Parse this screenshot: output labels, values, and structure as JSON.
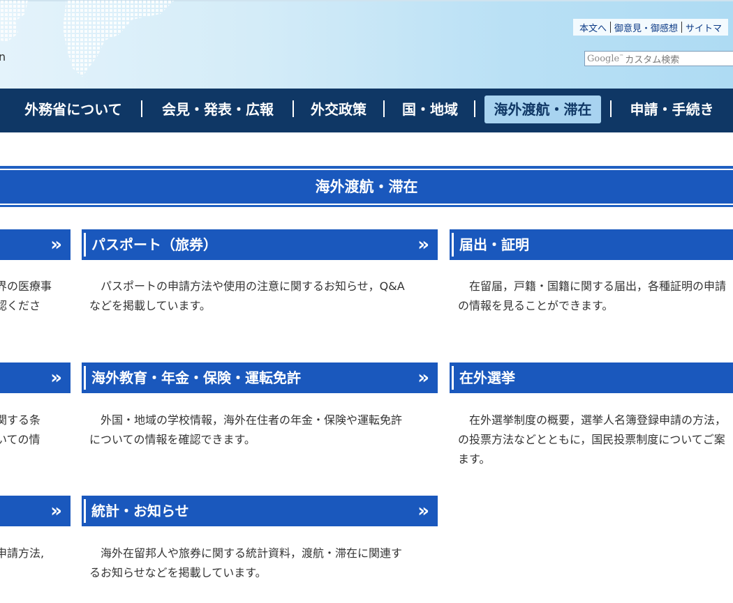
{
  "header": {
    "logo_fragment": "n",
    "utility_links": [
      "本文へ",
      "御意見・御感想",
      "サイトマ"
    ],
    "search": {
      "logo": "Google",
      "tm": "™",
      "placeholder": "カスタム検索"
    }
  },
  "nav": {
    "items": [
      {
        "label": "外務省について"
      },
      {
        "label": "会見・発表・広報"
      },
      {
        "label": "外交政策"
      },
      {
        "label": "国・地域"
      },
      {
        "label": "海外渡航・滞在",
        "active": true
      },
      {
        "label": "申請・手続き"
      }
    ]
  },
  "section": {
    "title": "海外渡航・滞在"
  },
  "cards": {
    "left": [
      {
        "chevron": "»",
        "text_lines": [
          "界の医療事",
          "認くださ"
        ]
      },
      {
        "chevron": "»",
        "text_lines": [
          "関する条",
          "いての情"
        ]
      },
      {
        "chevron": "»",
        "text_lines": [
          "申請方法,"
        ]
      }
    ],
    "middle": [
      {
        "title": "パスポート（旅券）",
        "chevron": "»",
        "text_lines": [
          "　パスポートの申請方法や使用の注意に関するお知らせ，Q&A",
          "などを掲載しています。"
        ]
      },
      {
        "title": "海外教育・年金・保険・運転免許",
        "chevron": "»",
        "text_lines": [
          "　外国・地域の学校情報，海外在住者の年金・保険や運転免許",
          "についての情報を確認できます。"
        ]
      },
      {
        "title": "統計・お知らせ",
        "chevron": "»",
        "text_lines": [
          "　海外在留邦人や旅券に関する統計資料，渡航・滞在に関連す",
          "るお知らせなどを掲載しています。"
        ]
      }
    ],
    "right": [
      {
        "title": "届出・証明",
        "text_lines": [
          "　在留届，戸籍・国籍に関する届出，各種証明の申請",
          "の情報を見ることができます。"
        ]
      },
      {
        "title": "在外選挙",
        "text_lines": [
          "　在外選挙制度の概要，選挙人名簿登録申請の方法，",
          "の投票方法などとともに，国民投票制度についてご案",
          "ます。"
        ]
      }
    ]
  },
  "colors": {
    "nav_bg": "#0f3765",
    "nav_active_bg": "#a8d3f0",
    "accent_blue": "#1a58bd",
    "header_bg": "#d4ecf8"
  }
}
